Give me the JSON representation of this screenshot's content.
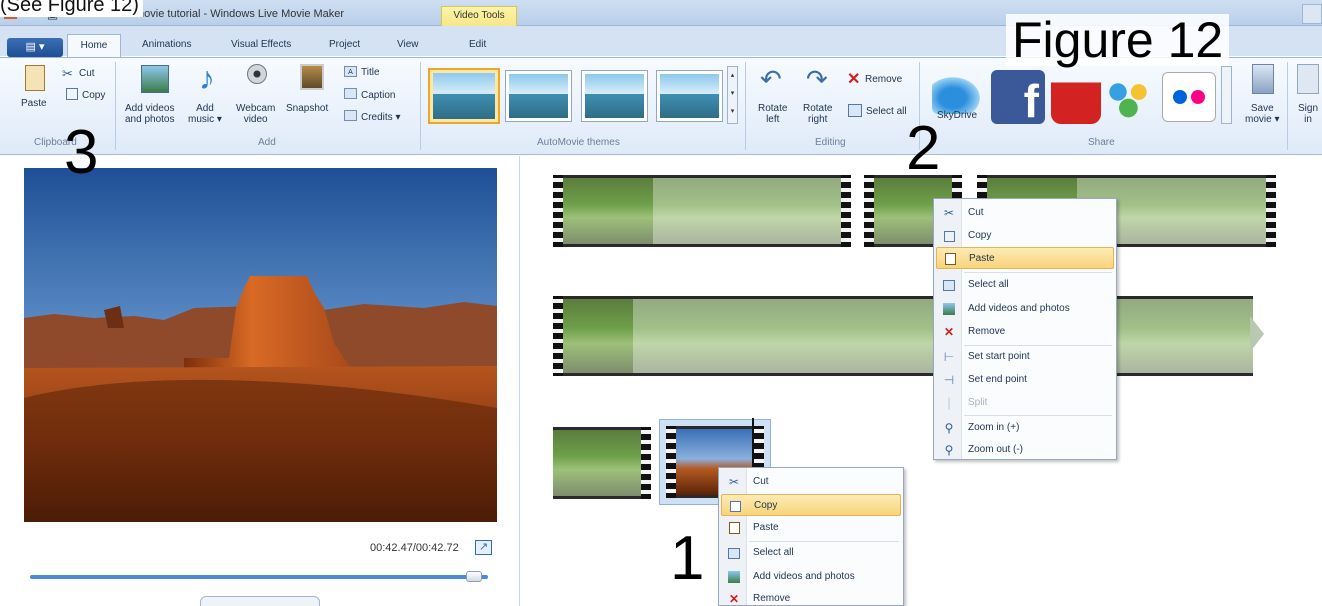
{
  "caption_top": "(See Figure 12)",
  "figure_label": "Figure 12",
  "annotations": {
    "one": "1",
    "two": "2",
    "three": "3"
  },
  "window": {
    "title": "movie tutorial - Windows Live Movie Maker",
    "context_tab_group": "Video Tools"
  },
  "tabs": [
    "Home",
    "Animations",
    "Visual Effects",
    "Project",
    "View",
    "Edit"
  ],
  "ribbon": {
    "clipboard": {
      "paste": "Paste",
      "cut": "Cut",
      "copy": "Copy",
      "group": "Clipboard"
    },
    "add": {
      "add_videos_l1": "Add videos",
      "add_videos_l2": "and photos",
      "add_music_l1": "Add",
      "add_music_l2": "music ▾",
      "webcam_l1": "Webcam",
      "webcam_l2": "video",
      "snapshot": "Snapshot",
      "title": "Title",
      "caption": "Caption",
      "credits": "Credits ▾",
      "group": "Add"
    },
    "themes": {
      "group": "AutoMovie themes"
    },
    "editing": {
      "rotate_left_l1": "Rotate",
      "rotate_left_l2": "left",
      "rotate_right_l1": "Rotate",
      "rotate_right_l2": "right",
      "remove": "Remove",
      "select_all": "Select all",
      "group": "Editing"
    },
    "share": {
      "skydrive": "SkyDrive",
      "save_movie_l1": "Save",
      "save_movie_l2": "movie ▾",
      "sign_in_l1": "Sign",
      "sign_in_l2": "in",
      "group": "Share"
    }
  },
  "preview": {
    "time": "00:42.47/00:42.72",
    "seek_position": 0.97
  },
  "menu_upper": {
    "items": [
      {
        "label": "Cut",
        "icon": "scissors-icon"
      },
      {
        "label": "Copy",
        "icon": "copy-icon"
      },
      {
        "label": "Paste",
        "icon": "paste-icon",
        "highlighted": true
      },
      {
        "label": "Select all",
        "icon": "select-all-icon"
      },
      {
        "label": "Add videos and photos",
        "icon": "add-media-icon"
      },
      {
        "label": "Remove",
        "icon": "remove-icon"
      },
      {
        "label": "Set start point",
        "icon": "start-point-icon"
      },
      {
        "label": "Set end point",
        "icon": "end-point-icon"
      },
      {
        "label": "Split",
        "icon": "split-icon",
        "disabled": true
      },
      {
        "label": "Zoom in (+)",
        "icon": "zoom-in-icon"
      },
      {
        "label": "Zoom out (-)",
        "icon": "zoom-out-icon"
      }
    ]
  },
  "menu_lower": {
    "items": [
      {
        "label": "Cut",
        "icon": "scissors-icon"
      },
      {
        "label": "Copy",
        "icon": "copy-icon",
        "highlighted": true
      },
      {
        "label": "Paste",
        "icon": "paste-icon"
      },
      {
        "label": "Select all",
        "icon": "select-all-icon"
      },
      {
        "label": "Add videos and photos",
        "icon": "add-media-icon"
      },
      {
        "label": "Remove",
        "icon": "remove-icon"
      }
    ]
  },
  "colors": {
    "highlight": "#f8d47a",
    "accent": "#2f6db7",
    "remove_red": "#d22020"
  }
}
